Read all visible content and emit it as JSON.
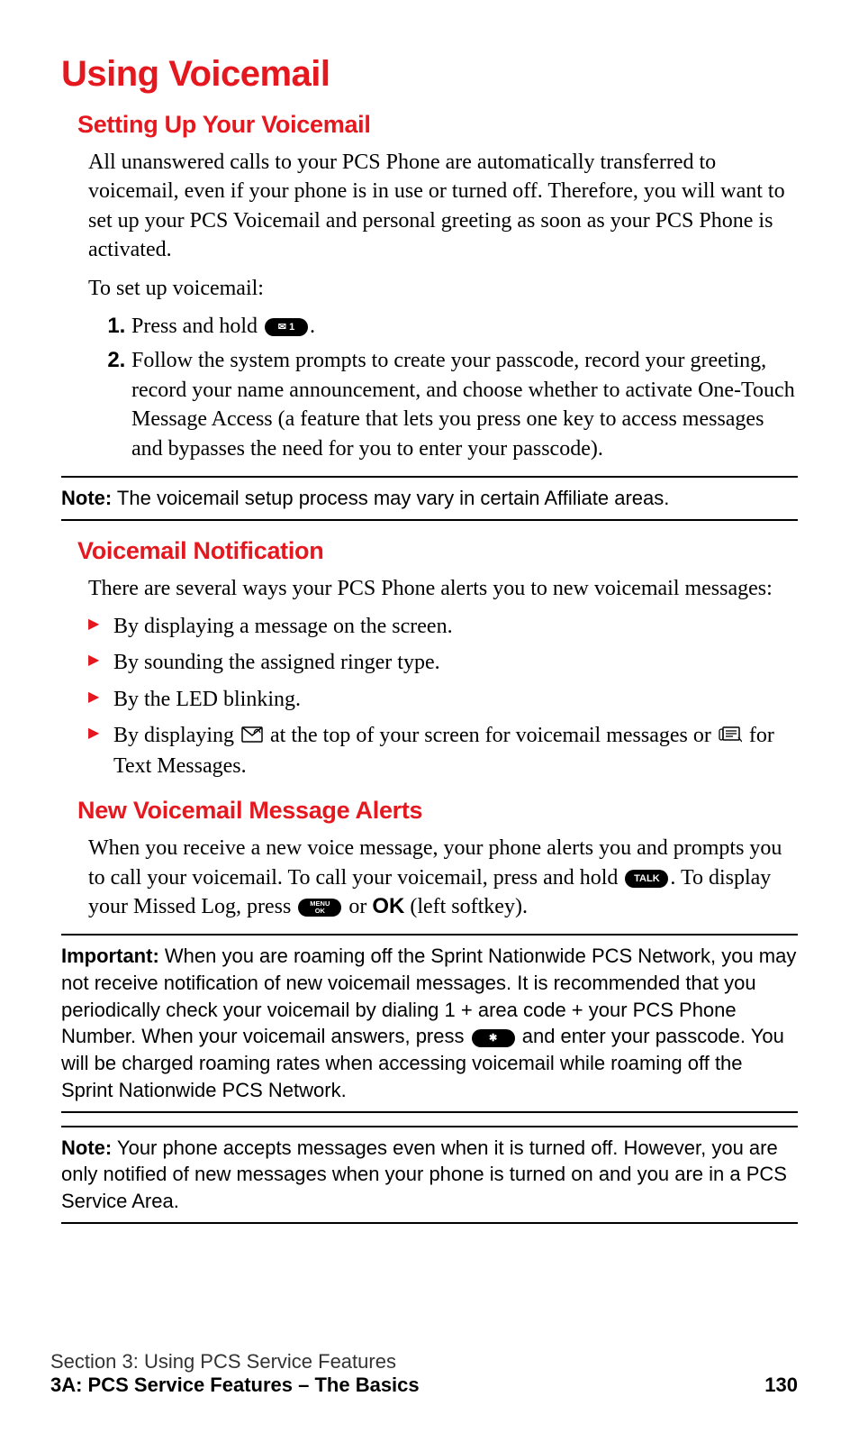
{
  "title": "Using Voicemail",
  "section1": {
    "heading": "Setting Up Your Voicemail",
    "para1": "All unanswered calls to your PCS Phone are automatically transferred to voicemail, even if your phone is in use or turned off. Therefore, you will want to set up your PCS Voicemail and personal greeting as soon as your PCS Phone is activated.",
    "lead_in": "To set up voicemail:",
    "step1_prefix": "Press and hold ",
    "step1_key": "✉ 1",
    "step1_suffix": ".",
    "step2": "Follow the system prompts to create your passcode, record your greeting, record your name announcement, and choose whether to activate One-Touch Message Access (a feature that lets you press one key to access messages and bypasses the need for you to enter your passcode)."
  },
  "note1": {
    "label": "Note:",
    "text": " The voicemail setup process may vary in certain Affiliate areas."
  },
  "section2": {
    "heading": "Voicemail Notification",
    "para1": "There are several ways your PCS Phone alerts you to new voicemail messages:",
    "b1": "By displaying a message on the screen.",
    "b2": "By sounding the assigned ringer type.",
    "b3": "By the LED blinking.",
    "b4_a": "By displaying ",
    "b4_b": " at the top of your screen for voicemail messages or ",
    "b4_c": " for Text Messages."
  },
  "section3": {
    "heading": "New Voicemail Message Alerts",
    "p_a": "When you receive a new voice message, your phone alerts you and prompts you to call your voicemail. To call your voicemail, press and hold ",
    "key_talk": "TALK",
    "p_b": ". To display your Missed Log, press ",
    "key_menu_line1": "MENU",
    "key_menu_line2": "OK",
    "p_c": " or ",
    "ok_word": "OK",
    "p_d": " (left softkey)."
  },
  "important": {
    "label": "Important:",
    "t1": " When you are roaming off the Sprint Nationwide PCS Network, you may not receive notification of new voicemail messages. It is recommended that you periodically check your voicemail by dialing 1 + area code + your PCS Phone Number. When your voicemail answers, press ",
    "key_star": "✱",
    "t2": " and enter your passcode. You will be charged roaming rates when accessing voicemail while roaming off the Sprint Nationwide PCS Network."
  },
  "note2": {
    "label": "Note:",
    "text": " Your phone accepts messages even when it is turned off. However, you are only notified of new messages when your phone is turned on and you are in a PCS Service Area."
  },
  "footer": {
    "line1": "Section 3: Using PCS Service Features",
    "line2": "3A: PCS Service Features – The Basics",
    "page": "130"
  }
}
